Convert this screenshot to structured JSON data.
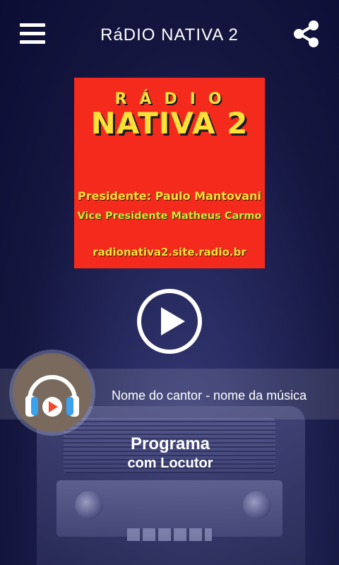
{
  "header": {
    "title": "RáDIO NATIVA 2",
    "menu_icon": "hamburger-menu-icon",
    "share_icon": "share-icon"
  },
  "logo": {
    "radio_word": "RÁDIO",
    "name": "NATIVA 2",
    "president": "Presidente: Paulo Mantovani",
    "vice_president": "Vice Presidente Matheus Carmo",
    "website": "radionativa2.site.radio.br",
    "colors": {
      "background": "#f42a1d",
      "text": "#ffe13a"
    }
  },
  "player": {
    "play_icon": "play-icon",
    "now_playing": "Nome do cantor - nome da música",
    "headphones_icon": "headphones-play-icon"
  },
  "program": {
    "title": "Programa",
    "announcer": "com Locutor"
  }
}
